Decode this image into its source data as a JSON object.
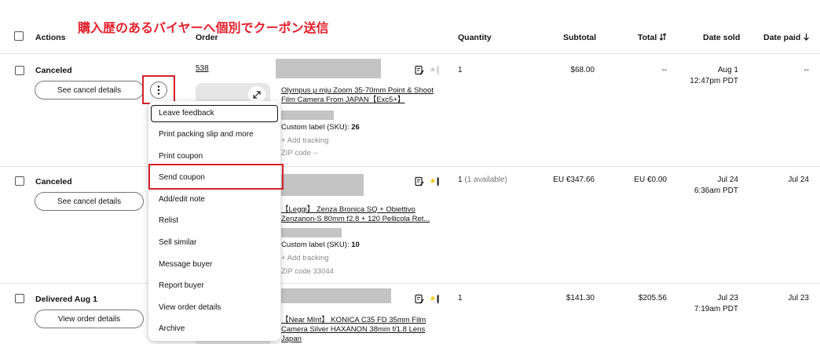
{
  "annotation": {
    "title": "購入歴のあるバイヤーへ個別でクーポン送信",
    "color": "#e4202d"
  },
  "table_headers": {
    "actions": "Actions",
    "order": "Order",
    "quantity": "Quantity",
    "subtotal": "Subtotal",
    "total": "Total",
    "total_sort_icon": "sort-arrows-icon",
    "date_sold": "Date sold",
    "date_paid": "Date paid",
    "date_paid_sort_icon": "arrow-down-icon"
  },
  "rows": [
    {
      "status": "Canceled",
      "action_button": "See cancel details",
      "order_number": "538",
      "title_line1": "Olympus μ mju Zoom 35-70mm Point & Shoot",
      "title_line2": "Film Camera From JAPAN【Exc5+】",
      "sku_label": "Custom label (SKU):",
      "sku_value": "26",
      "add_tracking": "+ Add tracking",
      "zip": "ZIP code --",
      "quantity": "1",
      "subtotal": "$68.00",
      "total": "--",
      "date_sold_date": "Aug 1",
      "date_sold_time": "12:47pm PDT",
      "date_paid": "--"
    },
    {
      "status": "Canceled",
      "action_button": "See cancel details",
      "title_line1": "【Leggi】 Zenza Bronica SQ + Obiettivo",
      "title_line2": "Zenzanon-S 80mm f2.8 + 120 Pellicola Ret...",
      "sku_label": "Custom label (SKU):",
      "sku_value": "10",
      "add_tracking": "+ Add tracking",
      "zip": "ZIP code 33044",
      "quantity": "1",
      "quantity_note": "(1 available)",
      "subtotal": "EU €347.66",
      "total": "EU €0.00",
      "date_sold_date": "Jul 24",
      "date_sold_time": "6:36am PDT",
      "date_paid": "Jul 24"
    },
    {
      "status": "Delivered Aug 1",
      "action_button": "View order details",
      "title_line1": "【Near MInt】 KONICA C35 FD 35mm Film",
      "title_line2": "Camera Silver HAXANON 38mm f/1.8 Lens",
      "title_line3": "Japan",
      "quantity": "1",
      "subtotal": "$141.30",
      "total": "$205.56",
      "date_sold_date": "Jul 23",
      "date_sold_time": "7:19am PDT",
      "date_paid": "Jul 23"
    }
  ],
  "menu": {
    "items": [
      "Leave feedback",
      "Print packing slip and more",
      "Print coupon",
      "Send coupon",
      "Add/edit note",
      "Relist",
      "Sell similar",
      "Message buyer",
      "Report buyer",
      "View order details",
      "Archive"
    ]
  },
  "icons": {
    "more": "more-vertical-icon",
    "expand": "expand-icon",
    "note": "note-edit-icon",
    "star_pen": "star-pen-icon"
  }
}
